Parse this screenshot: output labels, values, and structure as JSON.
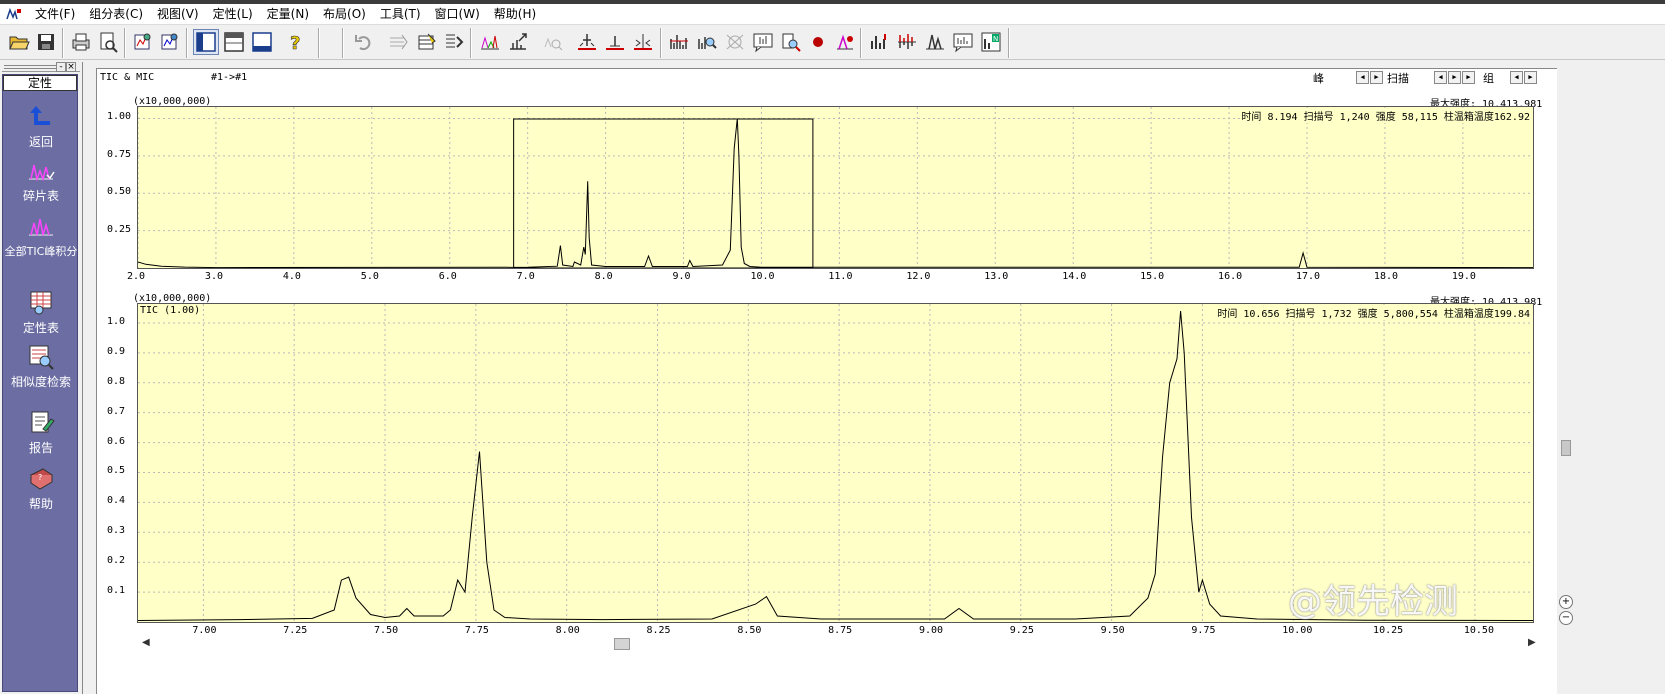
{
  "menu": [
    "文件(F)",
    "组分表(C)",
    "视图(V)",
    "定性(L)",
    "定量(N)",
    "布局(O)",
    "工具(T)",
    "窗口(W)",
    "帮助(H)"
  ],
  "sidebar": {
    "title": "定性",
    "items": [
      {
        "label": "返回",
        "icon": "back-arrow-icon"
      },
      {
        "label": "碎片表",
        "icon": "fragment-table-icon"
      },
      {
        "label": "全部TIC峰积分",
        "icon": "tic-integration-icon"
      },
      {
        "label": "定性表",
        "icon": "qualitative-table-icon"
      },
      {
        "label": "相似度检索",
        "icon": "similarity-search-icon"
      },
      {
        "label": "报告",
        "icon": "report-icon"
      },
      {
        "label": "帮助",
        "icon": "help-book-icon"
      }
    ]
  },
  "header": {
    "title": "TIC & MIC",
    "file_range": "#1->#1",
    "peak_label": "峰",
    "scan_label": "扫描",
    "group_label": "组"
  },
  "top_chart": {
    "scale_label": "(x10,000,000)",
    "max_intensity": "最大强度: 10,413,981",
    "status": "时间  8.194  扫描号 1,240  强度       58,115  柱温箱温度162.92",
    "y_ticks": [
      "1.00",
      "0.75",
      "0.50",
      "0.25"
    ],
    "x_ticks": [
      "2.0",
      "3.0",
      "4.0",
      "5.0",
      "6.0",
      "7.0",
      "8.0",
      "9.0",
      "10.0",
      "11.0",
      "12.0",
      "13.0",
      "14.0",
      "15.0",
      "16.0",
      "17.0",
      "18.0",
      "19.0"
    ]
  },
  "bottom_chart": {
    "scale_label": "(x10,000,000)",
    "max_intensity": "最大强度: 10,413,981",
    "trace_label": "TIC (1.00)",
    "status": "时间 10.656  扫描号 1,732  强度    5,800,554  柱温箱温度199.84",
    "y_ticks": [
      "1.0",
      "0.9",
      "0.8",
      "0.7",
      "0.6",
      "0.5",
      "0.4",
      "0.3",
      "0.2",
      "0.1"
    ],
    "x_ticks": [
      "7.00",
      "7.25",
      "7.50",
      "7.75",
      "8.00",
      "8.25",
      "8.50",
      "8.75",
      "9.00",
      "9.25",
      "9.50",
      "9.75",
      "10.00",
      "10.25",
      "10.50"
    ]
  },
  "watermark": "@领先检测",
  "colors": {
    "plot_bg": "#ffffc8",
    "sidebar": "#6c6ea3",
    "grid": "#b9b9b9"
  },
  "chart_data": [
    {
      "type": "line",
      "title": "TIC & MIC",
      "xlim": [
        2.0,
        19.9
      ],
      "ylim": [
        0,
        1.05
      ],
      "zoom_range": [
        6.82,
        10.66
      ],
      "series": [
        {
          "x": [
            2.0,
            2.1,
            2.3,
            2.6,
            3.0,
            5.0,
            7.0,
            7.38,
            7.42,
            7.45,
            7.58,
            7.6,
            7.68,
            7.72,
            7.74,
            7.77,
            7.79,
            7.82,
            8.0,
            8.5,
            8.55,
            8.6,
            9.05,
            9.08,
            9.12,
            9.5,
            9.6,
            9.65,
            9.69,
            9.71,
            9.74,
            9.78,
            9.85,
            10.0,
            16.9,
            16.95,
            17.0,
            19.9
          ],
          "y": [
            0.04,
            0.025,
            0.012,
            0.006,
            0.003,
            0.004,
            0.005,
            0.012,
            0.15,
            0.02,
            0.01,
            0.04,
            0.02,
            0.14,
            0.09,
            0.58,
            0.2,
            0.02,
            0.01,
            0.01,
            0.08,
            0.01,
            0.01,
            0.05,
            0.01,
            0.02,
            0.12,
            0.8,
            1.0,
            0.75,
            0.14,
            0.03,
            0.01,
            0.005,
            0.005,
            0.1,
            0.005,
            0.003
          ]
        }
      ]
    },
    {
      "type": "line",
      "title": "TIC (1.00)",
      "xlim": [
        6.82,
        10.66
      ],
      "ylim": [
        0,
        1.05
      ],
      "series": [
        {
          "name": "TIC (1.00)",
          "x": [
            6.82,
            7.1,
            7.3,
            7.36,
            7.38,
            7.4,
            7.42,
            7.46,
            7.5,
            7.54,
            7.56,
            7.58,
            7.62,
            7.66,
            7.68,
            7.7,
            7.72,
            7.74,
            7.76,
            7.78,
            7.8,
            7.83,
            7.9,
            8.1,
            8.4,
            8.52,
            8.55,
            8.58,
            8.7,
            9.04,
            9.08,
            9.12,
            9.4,
            9.55,
            9.6,
            9.62,
            9.64,
            9.66,
            9.68,
            9.69,
            9.7,
            9.72,
            9.74,
            9.75,
            9.77,
            9.8,
            9.9,
            10.2,
            10.66
          ],
          "y": [
            0.005,
            0.008,
            0.012,
            0.04,
            0.14,
            0.15,
            0.08,
            0.025,
            0.015,
            0.02,
            0.045,
            0.02,
            0.02,
            0.02,
            0.04,
            0.14,
            0.1,
            0.35,
            0.57,
            0.2,
            0.04,
            0.015,
            0.01,
            0.008,
            0.01,
            0.06,
            0.085,
            0.02,
            0.01,
            0.01,
            0.045,
            0.01,
            0.01,
            0.02,
            0.08,
            0.16,
            0.55,
            0.8,
            0.88,
            1.04,
            0.9,
            0.35,
            0.1,
            0.14,
            0.06,
            0.02,
            0.01,
            0.006,
            0.005
          ]
        }
      ]
    }
  ]
}
